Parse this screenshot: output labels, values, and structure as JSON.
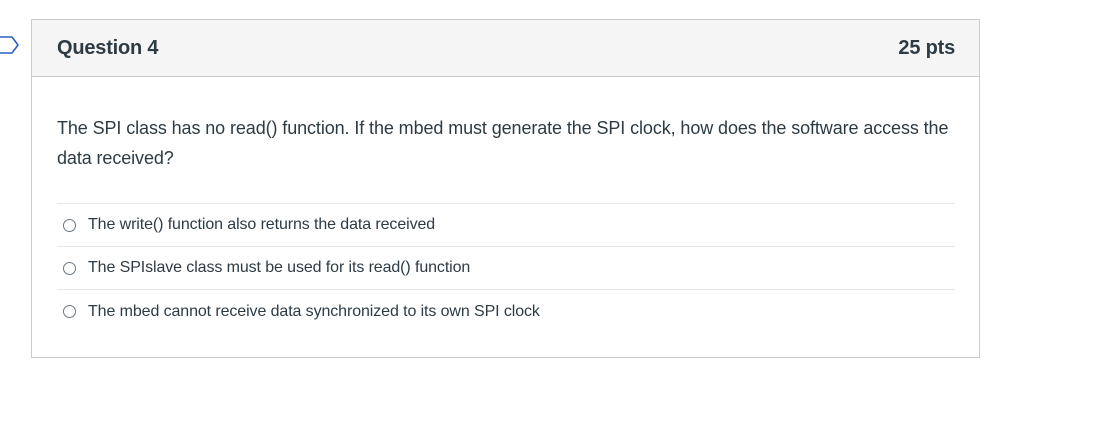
{
  "question": {
    "title": "Question 4",
    "points": "25 pts",
    "text": "The SPI class has no read() function. If the mbed must generate the SPI clock, how does the software access the data received?",
    "answers": [
      {
        "label": "The write() function also returns the data received"
      },
      {
        "label": "The SPIslave class must be used for its read() function"
      },
      {
        "label": "The mbed cannot receive data synchronized to its own SPI clock"
      }
    ]
  },
  "icons": {
    "question_flag": "bookmark-flag-icon"
  },
  "colors": {
    "text": "#2d3b45",
    "header_bg": "#f5f5f5",
    "border": "#c7cdd1"
  }
}
